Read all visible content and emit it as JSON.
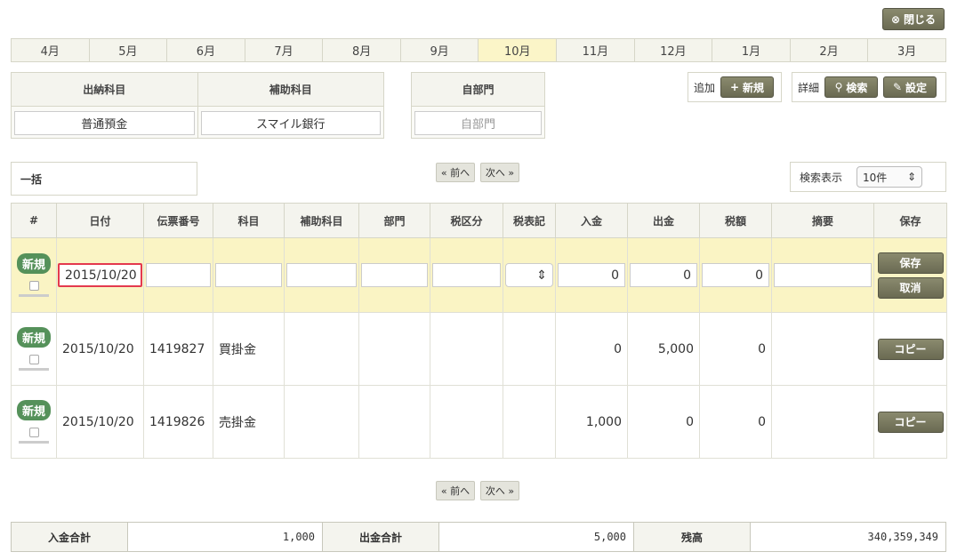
{
  "close": {
    "icon": "⊗",
    "label": "閉じる"
  },
  "months": [
    "4月",
    "5月",
    "6月",
    "7月",
    "8月",
    "9月",
    "10月",
    "11月",
    "12月",
    "1月",
    "2月",
    "3月"
  ],
  "active_month": "10月",
  "filters": {
    "account_label": "出納科目",
    "account_value": "普通預金",
    "sub_account_label": "補助科目",
    "sub_account_value": "スマイル銀行",
    "dept_label": "自部門",
    "dept_placeholder": "自部門"
  },
  "actions": {
    "add_label": "追加",
    "new_label": "新規",
    "detail_label": "詳細",
    "search_label": "検索",
    "settings_label": "設定"
  },
  "bulk_label": "一括",
  "pager": {
    "prev": "« 前へ",
    "next": "次へ »"
  },
  "search_display": {
    "label": "検索表示",
    "value": "10件"
  },
  "table": {
    "headers": [
      "#",
      "日付",
      "伝票番号",
      "科目",
      "補助科目",
      "部門",
      "税区分",
      "税表記",
      "入金",
      "出金",
      "税額",
      "摘要",
      "保存"
    ],
    "new_row": {
      "badge": "新規",
      "date": "2015/10/20",
      "deposit": "0",
      "withdrawal": "0",
      "tax": "0",
      "save_label": "保存",
      "cancel_label": "取消"
    },
    "rows": [
      {
        "badge": "新規",
        "date": "2015/10/20",
        "slip": "1419827",
        "account": "買掛金",
        "deposit": "0",
        "withdrawal": "5,000",
        "tax": "0",
        "action": "コピー"
      },
      {
        "badge": "新規",
        "date": "2015/10/20",
        "slip": "1419826",
        "account": "売掛金",
        "deposit": "1,000",
        "withdrawal": "0",
        "tax": "0",
        "action": "コピー"
      }
    ]
  },
  "totals": {
    "deposit_label": "入金合計",
    "deposit_value": "1,000",
    "withdrawal_label": "出金合計",
    "withdrawal_value": "5,000",
    "balance_label": "残高",
    "balance_value": "340,359,349"
  },
  "colors": {
    "accent": "#6a6a52",
    "active_month": "#fbf5c8",
    "new_row": "#faf4c4",
    "badge": "#55915a",
    "focus": "#e4394e"
  }
}
